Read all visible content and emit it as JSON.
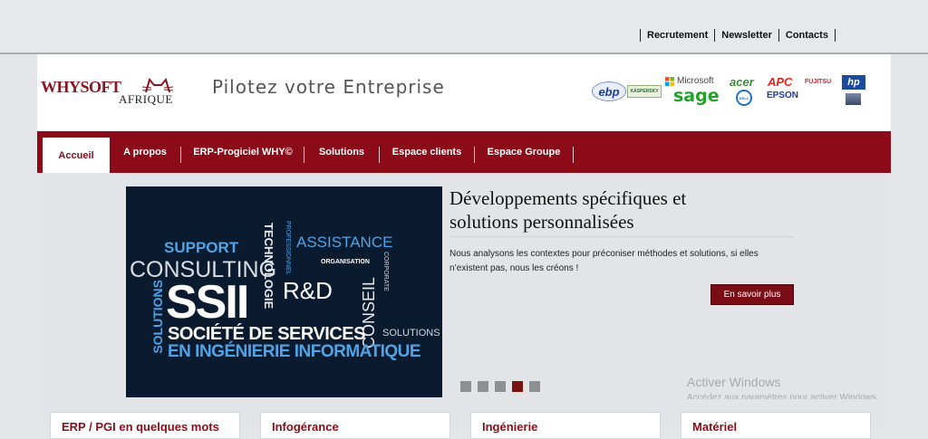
{
  "toplinks": {
    "recrutement": "Recrutement",
    "newsletter": "Newsletter",
    "contacts": "Contacts"
  },
  "header": {
    "logo_main": "WHYSOFT",
    "logo_sub": "AFRIQUE",
    "tagline": "Pilotez votre Entreprise"
  },
  "partners": {
    "ebp": "ebp",
    "kaspersky": "KASPERSKY",
    "microsoft": "Microsoft",
    "sage": "sage",
    "acer": "acer",
    "dell": "DELL",
    "apc": "APC",
    "epson": "EPSON",
    "fujitsu": "FUJITSU",
    "hp": "hp"
  },
  "nav": [
    "Accueil",
    "A propos",
    "ERP-Progiciel WHY©",
    "Solutions",
    "Espace clients",
    "Espace Groupe"
  ],
  "slide": {
    "title": "Développements spécifiques et solutions personnalisées",
    "text": "Nous analysons les contextes pour préconiser méthodes et solutions, si elles n’existent pas, nous les créons !",
    "button": "En savoir plus",
    "words": {
      "support": "SUPPORT",
      "consulting": "CONSULTING",
      "assistance": "ASSISTANCE",
      "organisation": "ORGANISATION",
      "ssii": "SSII",
      "rd": "R&D",
      "technologie": "TECHNOLOGIE",
      "professionnel": "PROFESSIONNEL",
      "conseil": "CONSEIL",
      "corporate": "CORPORATE",
      "solutions": "SOLUTIONS",
      "solutions_v": "SOLUTIONS",
      "societe": "SOCIÉTÉ DE SERVICES",
      "ingenierie": "EN INGÉNIERIE INFORMATIQUE"
    }
  },
  "slider_dots": {
    "count": 5,
    "active": 4
  },
  "watermark": {
    "title": "Activer Windows",
    "subtitle": "Accédez aux paramètres pour activer Windows."
  },
  "boxes": [
    "ERP / PGI en quelques mots",
    "Infogérance",
    "Ingénierie",
    "Matériel"
  ],
  "colors": {
    "brand": "#8b0c18",
    "button": "#7a0c16"
  }
}
